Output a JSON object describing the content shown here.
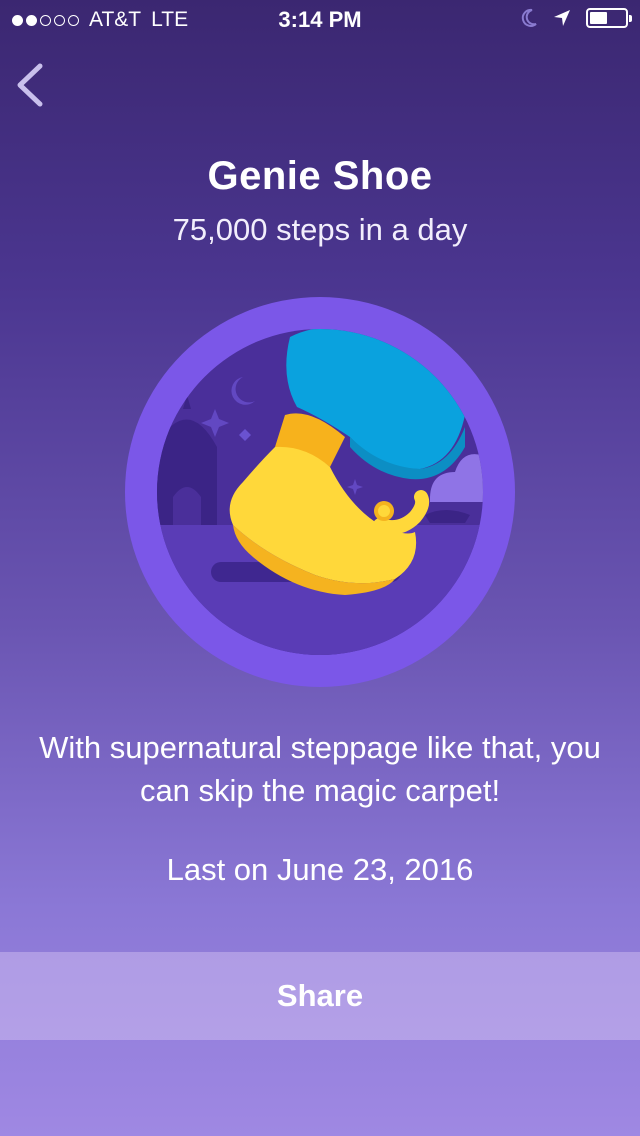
{
  "status_bar": {
    "signal_filled": 2,
    "signal_total": 5,
    "carrier": "AT&T",
    "network": "LTE",
    "time": "3:14 PM",
    "battery_level": 0.45
  },
  "nav": {
    "back_icon": "chevron-left-icon"
  },
  "badge": {
    "title": "Genie Shoe",
    "subtitle": "75,000 steps in a day",
    "image_icon": "genie-shoe-badge-icon",
    "description": "With supernatural steppage like that, you can skip the magic carpet!",
    "last_earned": "Last on June 23, 2016"
  },
  "actions": {
    "share_label": "Share"
  },
  "colors": {
    "background_top": "#3b2771",
    "background_bottom": "#9f88e3",
    "badge_ring": "#7b57e8",
    "badge_inner": "#4a2f9a",
    "shoe_yellow": "#ffd83a",
    "sleeve_blue": "#0aa2de"
  }
}
